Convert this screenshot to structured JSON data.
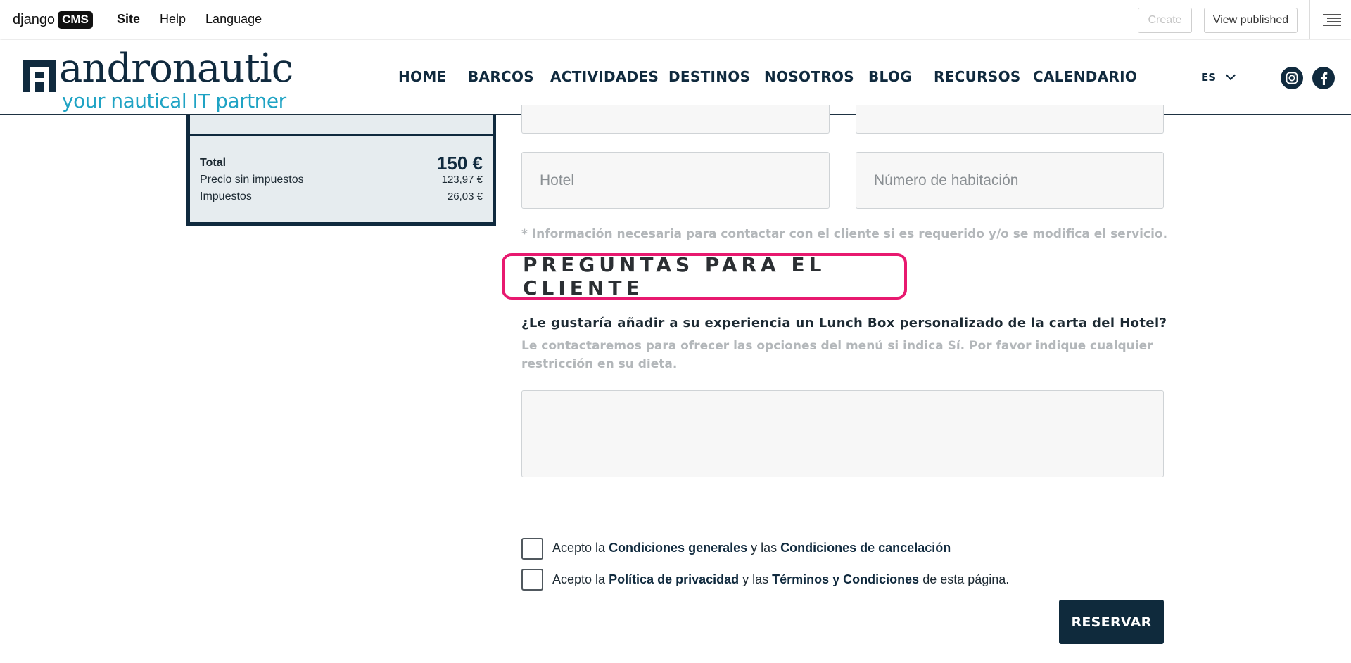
{
  "cms": {
    "logo_text": "django",
    "logo_badge": "CMS",
    "menu": [
      "Site",
      "Help",
      "Language"
    ],
    "create_label": "Create",
    "view_published_label": "View published"
  },
  "header": {
    "logo_word": "andronautic",
    "logo_tagline": "your nautical IT partner",
    "nav": [
      "HOME",
      "BARCOS",
      "ACTIVIDADES",
      "DESTINOS",
      "NOSOTROS",
      "BLOG",
      "RECURSOS",
      "CALENDARIO"
    ],
    "language": "ES"
  },
  "summary": {
    "total_label": "Total",
    "total_value": "150 €",
    "net_label": "Precio sin impuestos",
    "net_value": "123,97 €",
    "tax_label": "Impuestos",
    "tax_value": "26,03 €"
  },
  "form": {
    "hotel_placeholder": "Hotel",
    "room_placeholder": "Número de habitación",
    "note": "* Información necesaria para contactar con el cliente si es requerido y/o se modifica el servicio.",
    "section_title": "PREGUNTAS PARA EL CLIENTE",
    "question": "¿Le gustaría añadir a su experiencia un Lunch Box personalizado de la carta del Hotel?",
    "hint": "Le contactaremos para ofrecer las opciones del menú si indica Sí. Por favor indique cualquier restricción en su dieta.",
    "terms1": {
      "pre": "Acepto la ",
      "link1": "Condiciones generales",
      "mid": " y las ",
      "link2": "Condiciones de cancelación"
    },
    "terms2": {
      "pre": "Acepto la ",
      "link1": "Política de privacidad",
      "mid": " y las ",
      "link2": "Términos y Condiciones",
      "post": " de esta página."
    },
    "submit_label": "RESERVAR"
  },
  "colors": {
    "brand_navy": "#102a3e",
    "brand_cyan": "#1fa3c4",
    "highlight": "#e8196f"
  }
}
